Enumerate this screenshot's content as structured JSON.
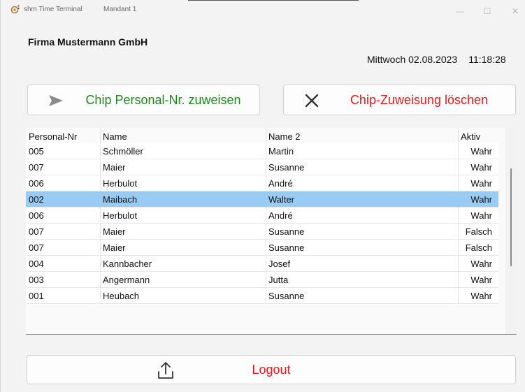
{
  "titlebar": {
    "app_title": "shm Time Terminal",
    "tenant": "Mandant 1",
    "min_glyph": "—",
    "max_glyph": "☐",
    "close_glyph": "✕"
  },
  "header": {
    "company": "Firma Mustermann GmbH",
    "date": "Mittwoch 02.08.2023",
    "time": "11:18:28"
  },
  "actions": {
    "assign_label": "Chip Personal-Nr. zuweisen",
    "assign_icon": "send-arrow-icon",
    "assign_color": "#1f8a1f",
    "delete_label": "Chip-Zuweisung löschen",
    "delete_icon": "close-x-icon",
    "delete_color": "#e21c1c",
    "logout_label": "Logout",
    "logout_icon": "upload-icon"
  },
  "grid": {
    "columns": [
      "Personal-Nr",
      "Name",
      "Name 2",
      "Aktiv"
    ],
    "selected_color": "#99ccf5",
    "rows": [
      {
        "nr": "005",
        "name": "Schmöller",
        "name2": "Martin",
        "aktiv": "Wahr"
      },
      {
        "nr": "007",
        "name": "Maier",
        "name2": "Susanne",
        "aktiv": "Wahr"
      },
      {
        "nr": "006",
        "name": "Herbulot",
        "name2": "André",
        "aktiv": "Wahr"
      },
      {
        "nr": "002",
        "name": "Maibach",
        "name2": "Walter",
        "aktiv": "Wahr",
        "selected": true
      },
      {
        "nr": "006",
        "name": "Herbulot",
        "name2": "André",
        "aktiv": "Wahr"
      },
      {
        "nr": "007",
        "name": "Maier",
        "name2": "Susanne",
        "aktiv": "Falsch"
      },
      {
        "nr": "007",
        "name": "Maier",
        "name2": "Susanne",
        "aktiv": "Falsch"
      },
      {
        "nr": "004",
        "name": "Kannbacher",
        "name2": "Josef",
        "aktiv": "Wahr"
      },
      {
        "nr": "003",
        "name": "Angermann",
        "name2": "Jutta",
        "aktiv": "Wahr"
      },
      {
        "nr": "001",
        "name": "Heubach",
        "name2": "Susanne",
        "aktiv": "Wahr"
      }
    ]
  }
}
